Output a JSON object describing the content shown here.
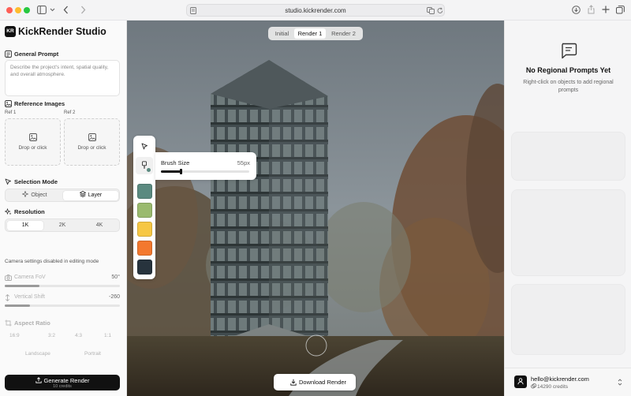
{
  "browser": {
    "url": "studio.kickrender.com"
  },
  "app": {
    "logo_text": "KR",
    "name": "KickRender Studio"
  },
  "general_prompt": {
    "title": "General Prompt",
    "placeholder": "Describe the project's intent, spatial quality, and overall atmosphere."
  },
  "reference_images": {
    "title": "Reference Images",
    "slots": [
      {
        "label": "Ref 1",
        "action": "Drop or click"
      },
      {
        "label": "Ref 2",
        "action": "Drop or click"
      }
    ]
  },
  "selection_mode": {
    "title": "Selection Mode",
    "options": [
      "Object",
      "Layer"
    ],
    "selected": "Layer"
  },
  "resolution": {
    "title": "Resolution",
    "options": [
      "1K",
      "2K",
      "4K"
    ],
    "selected": "1K"
  },
  "camera": {
    "notice": "Camera settings disabled in editing mode",
    "fov": {
      "label": "Camera FoV",
      "value": "50°",
      "level": 0.3
    },
    "shift": {
      "label": "Vertical Shift",
      "value": "-260",
      "level": 0.22
    }
  },
  "aspect_ratio": {
    "title": "Aspect Ratio",
    "options": [
      "16:9",
      "3:2",
      "4:3",
      "1:1"
    ],
    "orientations": [
      "Landscape",
      "Portrait"
    ]
  },
  "generate": {
    "label": "Generate Render",
    "sub": "10 credits"
  },
  "render_tabs": {
    "items": [
      "Initial",
      "Render 1",
      "Render 2"
    ],
    "selected": "Render 1"
  },
  "brush": {
    "label": "Brush Size",
    "value": "55px",
    "level": 0.22
  },
  "swatches": [
    "#5b8a80",
    "#9aba6e",
    "#f6c744",
    "#f3782e",
    "#27333d"
  ],
  "download": {
    "label": "Download Render"
  },
  "regional": {
    "title": "No Regional Prompts Yet",
    "hint": "Right-click on objects to add regional prompts"
  },
  "user": {
    "email": "hello@kickrender.com",
    "credits": "14290 credits"
  },
  "colors": {
    "accent": "#111111",
    "sidebar_bg": "#fafafa",
    "image_fog": "#7e878d"
  }
}
